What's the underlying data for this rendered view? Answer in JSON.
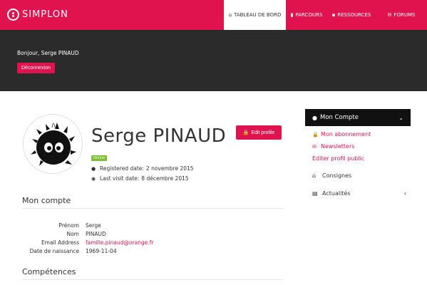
{
  "brand": {
    "name": "SIMPLON"
  },
  "nav": [
    {
      "label": "TABLEAU DE BORD",
      "icon": "home-icon",
      "active": true
    },
    {
      "label": "PARCOURS",
      "icon": "book-icon",
      "active": false
    },
    {
      "label": "RESSOURCES",
      "icon": "box-icon",
      "active": false
    },
    {
      "label": "FORUMS",
      "icon": "comments-icon",
      "active": false
    }
  ],
  "header": {
    "greeting": "Bonjour, Serge PINAUD",
    "logout_label": "Déconnexion"
  },
  "profile": {
    "name": "Serge PINAUD",
    "status": "Online",
    "registered_label": "Registered date:",
    "registered_value": "2 novembre 2015",
    "last_visit_label": "Last visit date:",
    "last_visit_value": "8 décembre 2015",
    "edit_label": "Edit profile"
  },
  "account": {
    "title": "Mon compte",
    "rows": [
      {
        "label": "Prénom",
        "value": "Serge"
      },
      {
        "label": "Nom",
        "value": "PINAUD"
      },
      {
        "label": "Email Address",
        "value": "famille.pinaud@orange.fr"
      },
      {
        "label": "Date de naissance",
        "value": "1969-11-04"
      }
    ]
  },
  "skills": {
    "title": "Compétences"
  },
  "sidebar": {
    "header": "Mon Compte",
    "links": [
      {
        "label": "Mon abonnement",
        "icon": "lock-icon"
      },
      {
        "label": "Newsletters",
        "icon": "envelope-icon"
      },
      {
        "label": "Editer profil public",
        "icon": ""
      }
    ],
    "items": [
      {
        "label": "Consignes",
        "icon": "bank-icon"
      },
      {
        "label": "Actualités",
        "icon": "newspaper-icon"
      }
    ]
  },
  "colors": {
    "accent": "#e0134f",
    "dark_band": "#2b2b2b",
    "online": "#7cbf36"
  }
}
